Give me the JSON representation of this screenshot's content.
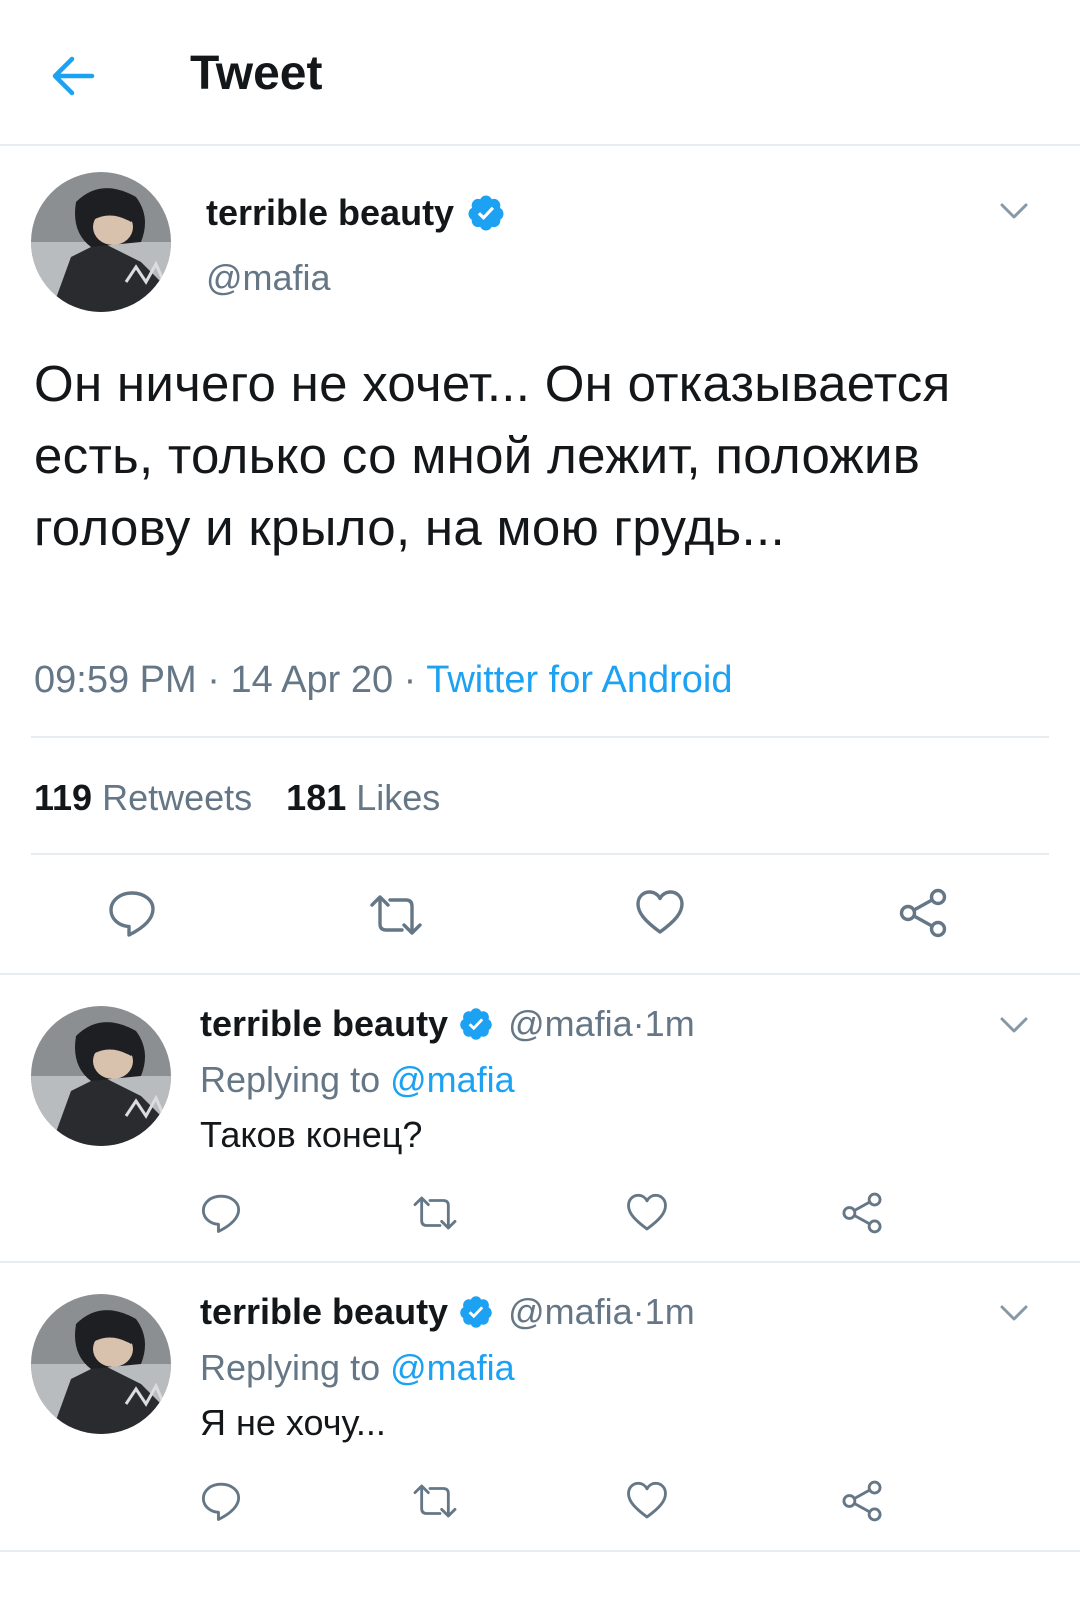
{
  "header": {
    "title": "Tweet"
  },
  "colors": {
    "accent": "#1da1f2",
    "secondary_text": "#657786",
    "divider": "#e6ecf0"
  },
  "main_tweet": {
    "display_name": "terrible beauty",
    "handle": "@mafia",
    "text": "Он ничего не хочет... Он отказывается есть, только со мной лежит, положив голову и крыло, на мою грудь...",
    "time": "09:59 PM",
    "date": "14 Apr 20",
    "separator": " · ",
    "source": "Twitter for Android",
    "retweets_count": "119",
    "retweets_label": "Retweets",
    "likes_count": "181",
    "likes_label": "Likes"
  },
  "replies": [
    {
      "display_name": "terrible beauty",
      "handle": "@mafia",
      "time_ago": "1m",
      "replying_label": "Replying to",
      "replying_handle": "@mafia",
      "text": "Таков конец?"
    },
    {
      "display_name": "terrible beauty",
      "handle": "@mafia",
      "time_ago": "1m",
      "replying_label": "Replying to",
      "replying_handle": "@mafia",
      "text": "Я не хочу..."
    }
  ],
  "icons": [
    "back-arrow-icon",
    "verified-badge-icon",
    "chevron-down-icon",
    "reply-icon",
    "retweet-icon",
    "like-icon",
    "share-icon"
  ]
}
